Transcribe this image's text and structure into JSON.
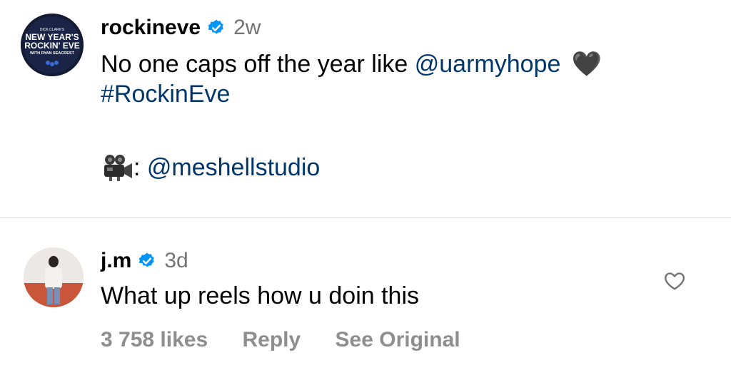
{
  "post": {
    "avatar_text": {
      "line1": "DICK CLARK'S",
      "line2": "NEW YEAR'S",
      "line3": "ROCKIN' EVE",
      "line4": "WITH RYAN SEACREST"
    },
    "username": "rockineve",
    "verified": true,
    "time": "2w",
    "caption_text": "No one caps off the year like ",
    "caption_mention": "@uarmyhope",
    "caption_emoji": "🖤",
    "hashtag": "#RockinEve",
    "credit_sep": ": ",
    "credit_mention": "@meshellstudio",
    "credit_icon": "movie-camera-icon"
  },
  "comment": {
    "username": "j.m",
    "verified": true,
    "time": "3d",
    "text": "What up reels how u doin this",
    "likes": "3 758 likes",
    "reply": "Reply",
    "see_original": "See Original",
    "like_icon": "heart-outline-icon"
  },
  "colors": {
    "link": "#00376b",
    "muted": "#737373",
    "verified_blue": "#0095f6",
    "divider": "#dbdbdb"
  }
}
